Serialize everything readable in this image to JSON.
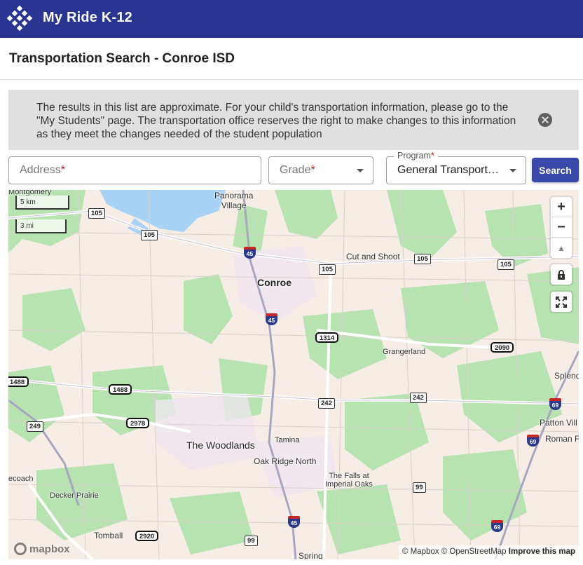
{
  "app": {
    "title": "My Ride K-12"
  },
  "page": {
    "title": "Transportation Search - Conroe ISD"
  },
  "notice": {
    "text": "The results in this list are approximate. For your child's transportation information, please go to the \"My Students\" page. The transportation office reserves the right to make changes to this information as they meet the changes needed of the student population"
  },
  "form": {
    "address_placeholder": "Address",
    "grade_placeholder": "Grade",
    "required_mark": "*",
    "program_label": "Program",
    "program_value": "General Transportation",
    "search_label": "Search"
  },
  "map": {
    "controls": {
      "zoom_in": "+",
      "zoom_out": "−",
      "compass": "▲"
    },
    "scale_km": "5 km",
    "scale_mi": "3 mi",
    "attribution_prefix": "© Mapbox © OpenStreetMap",
    "attribution_improve": "Improve this map",
    "mapbox_logo_text": "mapbox",
    "places": [
      {
        "key": "montgomery",
        "text": "Montgomery"
      },
      {
        "key": "panorama",
        "text": "Panorama\nVillage"
      },
      {
        "key": "conroe",
        "text": "Conroe"
      },
      {
        "key": "cut_and_shoot",
        "text": "Cut and Shoot"
      },
      {
        "key": "grangerland",
        "text": "Grangerland"
      },
      {
        "key": "splendora",
        "text": "Splend"
      },
      {
        "key": "patton_village",
        "text": "Patton Vill"
      },
      {
        "key": "roman_forest",
        "text": "Roman F"
      },
      {
        "key": "the_woodlands",
        "text": "The Woodlands"
      },
      {
        "key": "tamina",
        "text": "Tamina"
      },
      {
        "key": "oak_ridge_north",
        "text": "Oak Ridge North"
      },
      {
        "key": "falls_imperial_oaks",
        "text": "The Falls at\nImperial Oaks"
      },
      {
        "key": "decker_prairie",
        "text": "Decker Prairie"
      },
      {
        "key": "tomball",
        "text": "Tomball"
      },
      {
        "key": "spring",
        "text": "Spring"
      },
      {
        "key": "pinehurst_partial",
        "text": "ecoach"
      }
    ],
    "routes": {
      "state_105_a": "105",
      "state_105_b": "105",
      "state_105_c": "105",
      "state_105_d": "105",
      "state_105_e": "105",
      "fm_1314": "1314",
      "fm_2090": "2090",
      "fm_1488_a": "1488",
      "fm_1488_b": "1488",
      "fm_2978": "2978",
      "fm_2920": "2920",
      "state_242_a": "242",
      "state_242_b": "242",
      "state_249": "249",
      "state_99_a": "99",
      "state_99_b": "99",
      "i45_a": "45",
      "i45_b": "45",
      "i45_c": "45",
      "i69_a": "69",
      "i69_b": "69",
      "i69_c": "69"
    }
  }
}
